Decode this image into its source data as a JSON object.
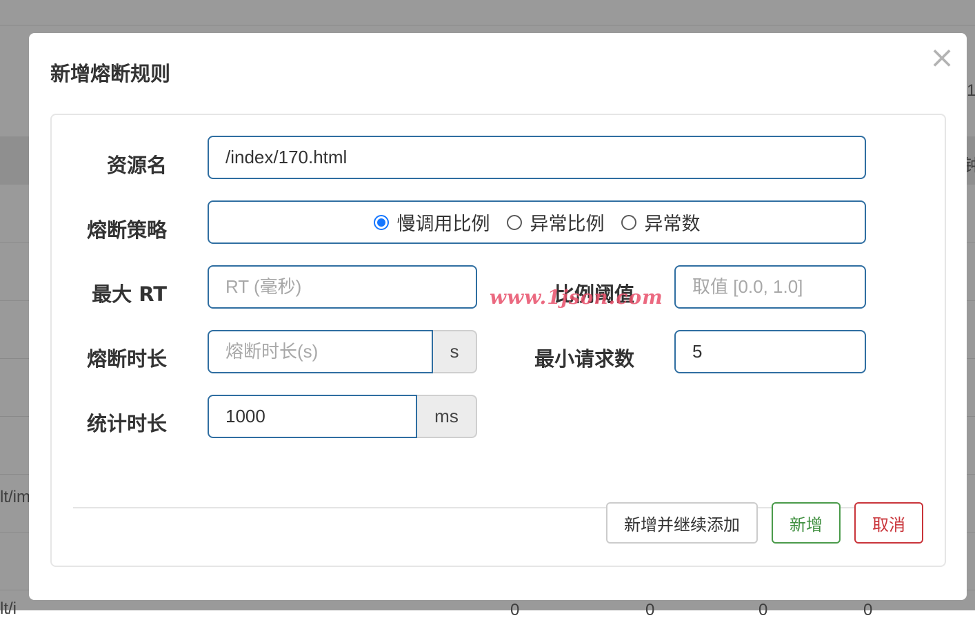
{
  "background": {
    "fragments": [
      "1",
      "钟",
      "lt/im",
      "lt/i",
      "0",
      "0",
      "0",
      "0"
    ]
  },
  "modal": {
    "title": "新增熔断规则",
    "close_glyph": "×"
  },
  "form": {
    "resource": {
      "label": "资源名",
      "value": "/index/170.html"
    },
    "strategy": {
      "label": "熔断策略",
      "options": [
        "慢调用比例",
        "异常比例",
        "异常数"
      ],
      "selected_index": 0
    },
    "max_rt": {
      "label": "最大 RT",
      "placeholder": "RT (毫秒)"
    },
    "ratio_threshold": {
      "label": "比例阈值",
      "placeholder": "取值 [0.0, 1.0]"
    },
    "break_duration": {
      "label": "熔断时长",
      "placeholder": "熔断时长(s)",
      "unit": "s"
    },
    "min_requests": {
      "label": "最小请求数",
      "value": "5"
    },
    "stat_duration": {
      "label": "统计时长",
      "value": "1000",
      "unit": "ms"
    }
  },
  "actions": {
    "add_continue": "新增并继续添加",
    "add": "新增",
    "cancel": "取消"
  },
  "watermark": "www.1json.com",
  "colors": {
    "accent": "#2f6ea1",
    "radio_checked": "#1677ff",
    "success": "#3f8f3f",
    "danger": "#c9343a"
  }
}
